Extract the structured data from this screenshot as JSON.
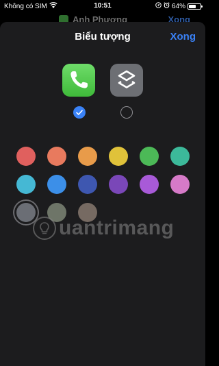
{
  "status_bar": {
    "carrier": "Không có SIM",
    "time": "10:51",
    "battery": "64%",
    "battery_level": 0.64,
    "icons": [
      "wifi-icon",
      "location-icon",
      "alarm-icon",
      "battery-icon"
    ]
  },
  "background_screen": {
    "title": "Anh Phương",
    "done_label": "Xong"
  },
  "sheet": {
    "title": "Biểu tượng",
    "done_label": "Xong"
  },
  "icon_choices": [
    {
      "name": "phone-app-icon",
      "selected": true
    },
    {
      "name": "shortcuts-app-icon",
      "selected": false
    }
  ],
  "colors": [
    "#e0605e",
    "#e87a5e",
    "#e89b4a",
    "#e0c23a",
    "#4cb957",
    "#3cb99a",
    "#45b8d4",
    "#3c8fe8",
    "#3e57b0",
    "#7a47b8",
    "#a85ad8",
    "#d67ac8",
    "#6b6e75",
    "#6e7568",
    "#766a62"
  ],
  "selected_color_index": 12,
  "watermark": {
    "text": "uantrimang"
  },
  "accent_color": "#3a82f7"
}
